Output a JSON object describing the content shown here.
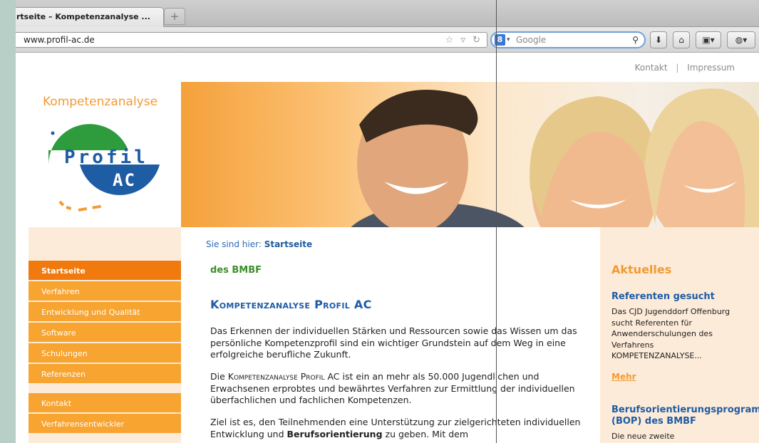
{
  "browser": {
    "tab_title": "rtseite – Kompetenzanalyse ...",
    "url": "www.profil-ac.de",
    "search_placeholder": "Google"
  },
  "header": {
    "links": [
      "Kontakt",
      "Impressum"
    ],
    "separator": "|"
  },
  "logo": {
    "title": "Kompetenzanalyse",
    "word1": "Profil",
    "word2": "AC"
  },
  "sidebar": {
    "items": [
      {
        "label": "Startseite",
        "active": true
      },
      {
        "label": "Verfahren"
      },
      {
        "label": "Entwicklung und Qualität"
      },
      {
        "label": "Software"
      },
      {
        "label": "Schulungen"
      },
      {
        "label": "Referenzen"
      }
    ],
    "items2": [
      {
        "label": "Kontakt"
      },
      {
        "label": "Verfahrensentwickler"
      }
    ]
  },
  "content": {
    "breadcrumb_prefix": "Sie sind hier:",
    "breadcrumb_current": "Startseite",
    "subtitle": "des BMBF",
    "heading": "Kompetenzanalyse Profil AC",
    "p1": "Das Erkennen der individuellen Stärken und Ressourcen sowie das Wissen um das persönliche Kompetenzprofil sind ein wichtiger Grundstein auf dem Weg in eine erfolgreiche berufliche Zukunft.",
    "p2_a": "Die ",
    "p2_sc": "Kompetenzanalyse Profil",
    "p2_b": " AC ist ein an mehr als 50.000 Jugendlichen und Erwachsenen erprobtes und bewährtes Verfahren zur Ermittlung der individuellen überfachlichen und fachlichen Kompetenzen.",
    "p3_a": "Ziel ist es, den Teilnehmenden eine Unterstützung zur zielgerichteten individuellen Entwicklung und ",
    "p3_bold": "Berufsorientierung",
    "p3_b": " zu geben. Mit dem"
  },
  "news": {
    "heading": "Aktuelles",
    "item1_title": "Referenten gesucht",
    "item1_text": "Das CJD Jugenddorf Offenburg sucht Referenten für Anwenderschulungen des Verfahrens KOMPETENZANALYSE...",
    "more": "Mehr",
    "item2_title_line1": "Berufsorientierungsprogram",
    "item2_title_line2": "(BOP) des BMBF",
    "item2_text": "Die neue zweite"
  },
  "colors": {
    "accent_orange": "#f39a33",
    "menu_orange": "#f7a431",
    "link_blue": "#1e5ca4",
    "green": "#3c8e2a",
    "panel_bg": "#fdebd9"
  }
}
